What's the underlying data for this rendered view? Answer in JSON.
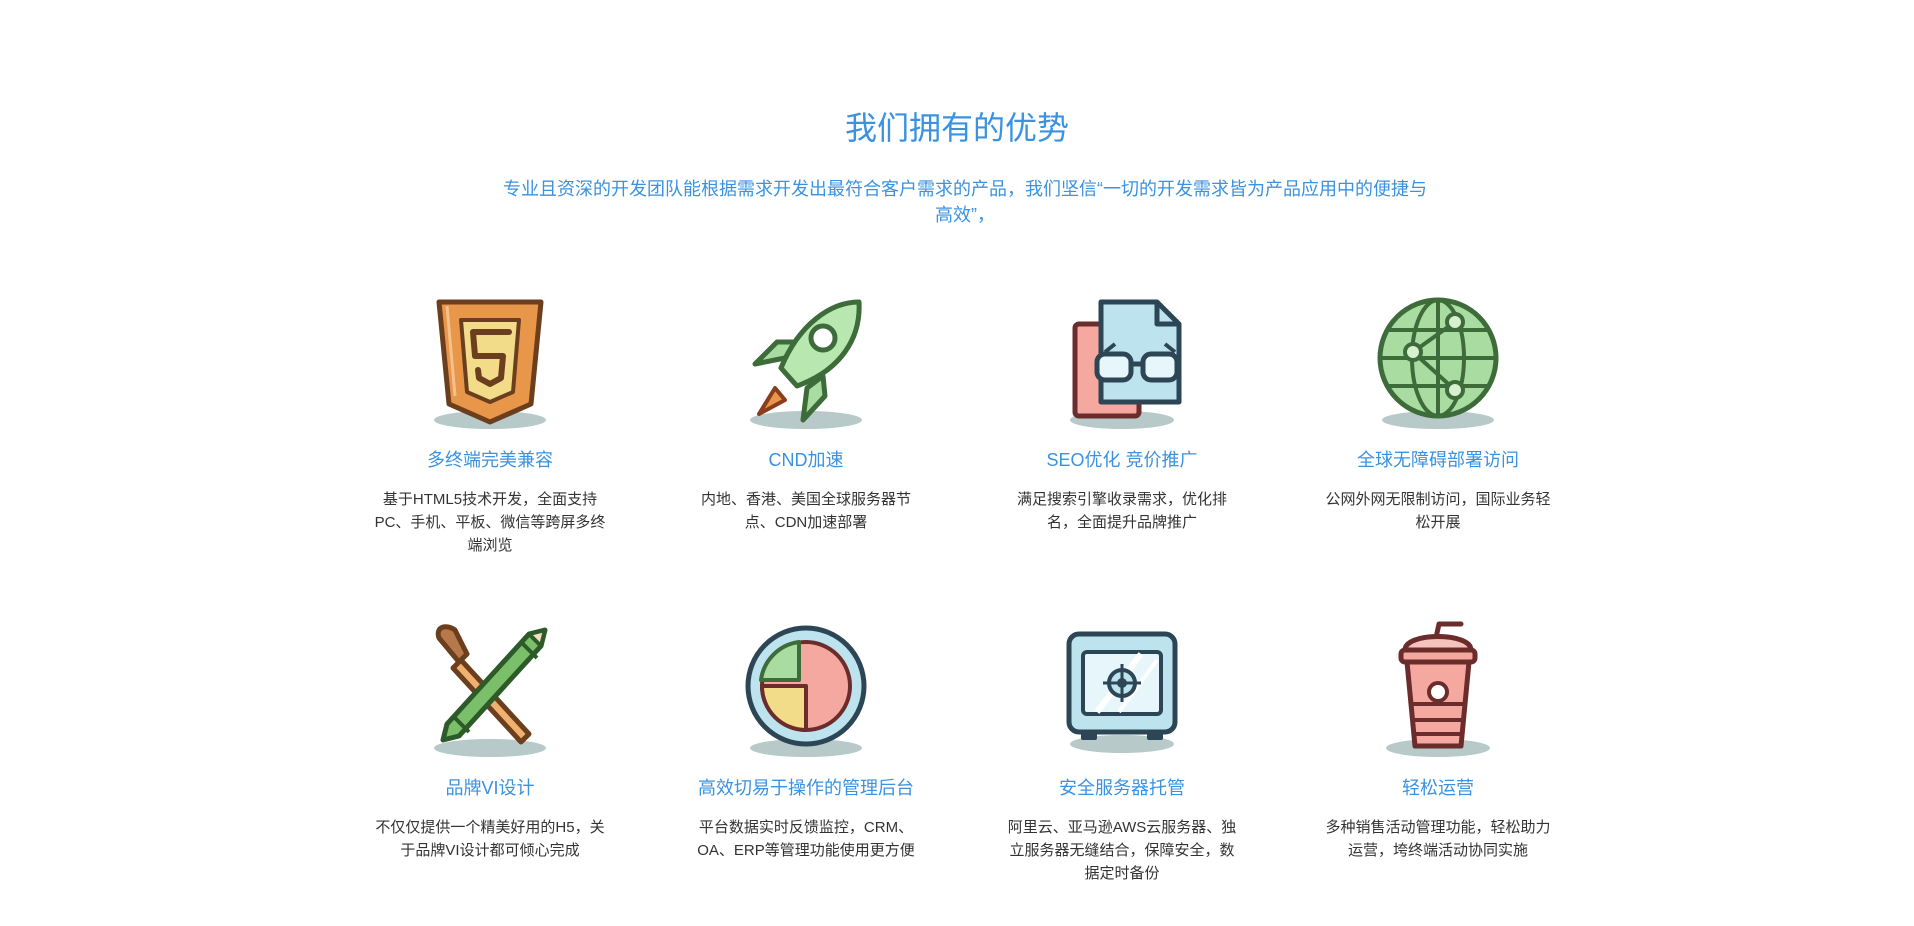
{
  "section": {
    "title": "我们拥有的优势",
    "subtitle": "专业且资深的开发团队能根据需求开发出最符合客户需求的产品，我们坚信“一切的开发需求皆为产品应用中的便捷与高效”，"
  },
  "features": [
    {
      "icon": "html5-shield-icon",
      "title": "多终端完美兼容",
      "desc": "基于HTML5技术开发，全面支持PC、手机、平板、微信等跨屏多终端浏览"
    },
    {
      "icon": "rocket-icon",
      "title": "CND加速",
      "desc": "内地、香港、美国全球服务器节点、CDN加速部署"
    },
    {
      "icon": "document-glasses-icon",
      "title": "SEO优化 竞价推广",
      "desc": "满足搜索引擎收录需求，优化排名，全面提升品牌推广"
    },
    {
      "icon": "globe-network-icon",
      "title": "全球无障碍部署访问",
      "desc": "公网外网无限制访问，国际业务轻松开展"
    },
    {
      "icon": "brush-pencil-icon",
      "title": "品牌VI设计",
      "desc": "不仅仅提供一个精美好用的H5，关于品牌VI设计都可倾心完成"
    },
    {
      "icon": "pie-chart-icon",
      "title": "高效切易于操作的管理后台",
      "desc": "平台数据实时反馈监控，CRM、OA、ERP等管理功能使用更方便"
    },
    {
      "icon": "safe-icon",
      "title": "安全服务器托管",
      "desc": "阿里云、亚马逊AWS云服务器、独立服务器无缝结合，保障安全，数据定时备份"
    },
    {
      "icon": "drink-cup-icon",
      "title": "轻松运营",
      "desc": "多种销售活动管理功能，轻松助力运营，垮终端活动协同实施"
    }
  ]
}
